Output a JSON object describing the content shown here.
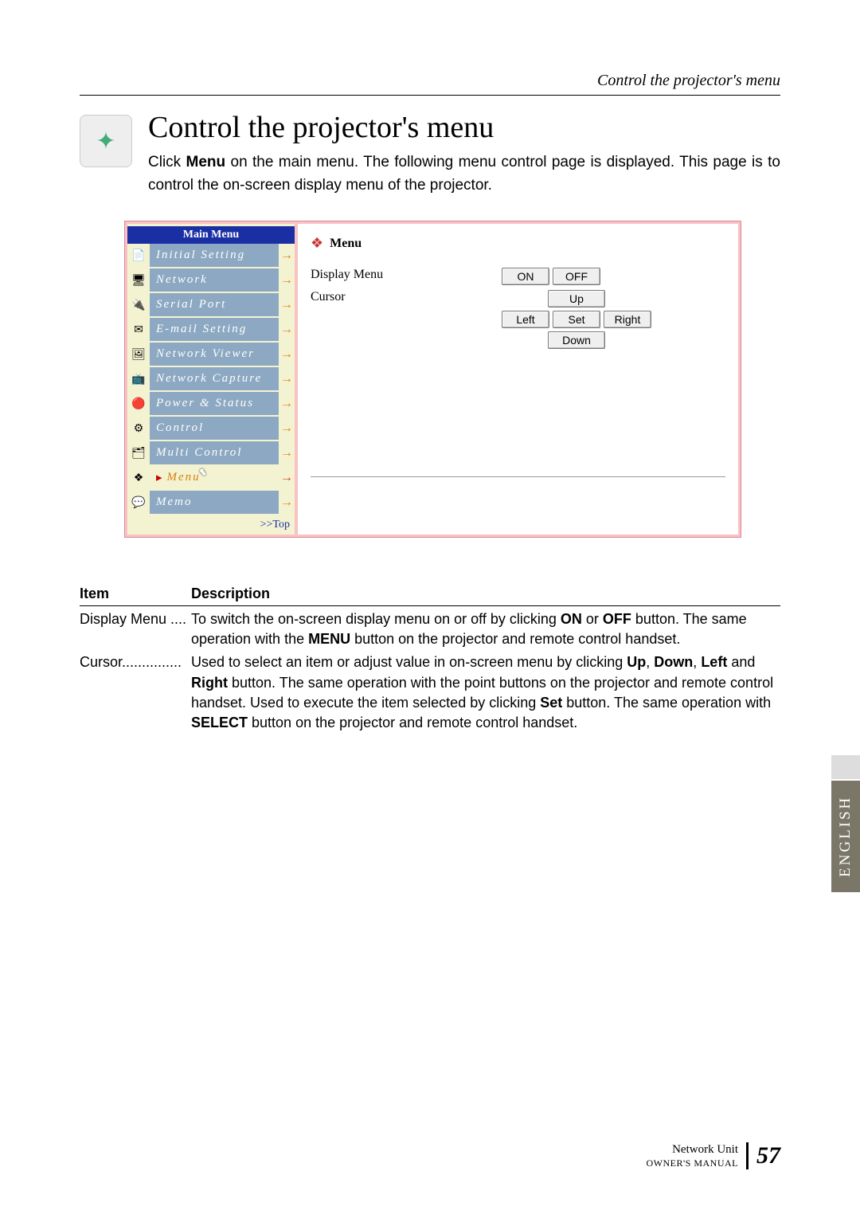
{
  "header": {
    "running_head": "Control the projector's menu",
    "title": "Control the projector's menu",
    "intro_parts": {
      "p1": "Click ",
      "b1": "Menu",
      "p2": " on the main menu. The following menu control page is displayed. This page is to control the on-screen display menu of the projector."
    }
  },
  "sidebar": {
    "title": "Main Menu",
    "items": [
      {
        "label": "Initial Setting",
        "icon": "📄"
      },
      {
        "label": "Network",
        "icon": "🖥"
      },
      {
        "label": "Serial Port",
        "icon": "🔌"
      },
      {
        "label": "E-mail Setting",
        "icon": "✉"
      },
      {
        "label": "Network Viewer",
        "icon": "🖼"
      },
      {
        "label": "Network Capture",
        "icon": "📺"
      },
      {
        "label": "Power & Status",
        "icon": "🔴"
      },
      {
        "label": "Control",
        "icon": "⚙"
      },
      {
        "label": "Multi Control",
        "icon": "🗂"
      },
      {
        "label": "Menu",
        "icon": "❖",
        "active": true
      },
      {
        "label": "Memo",
        "icon": "💬"
      }
    ],
    "top_link": ">>Top"
  },
  "panel": {
    "title": "Menu",
    "rows": {
      "display_menu": {
        "label": "Display Menu",
        "buttons": [
          "ON",
          "OFF"
        ]
      },
      "cursor": {
        "label": "Cursor",
        "up": "Up",
        "down": "Down",
        "left": "Left",
        "set": "Set",
        "right": "Right"
      }
    }
  },
  "table": {
    "head_item": "Item",
    "head_desc": "Description",
    "rows": [
      {
        "item": "Display Menu",
        "dots": " ....",
        "desc_parts": [
          {
            "t": "To switch the on-screen display menu on or off by clicking "
          },
          {
            "b": "ON"
          },
          {
            "t": " or "
          },
          {
            "b": "OFF"
          },
          {
            "t": " button. The same operation with the "
          },
          {
            "b": "MENU"
          },
          {
            "t": " button on the projector and remote control handset."
          }
        ]
      },
      {
        "item": "Cursor",
        "dots": "...............",
        "desc_parts": [
          {
            "t": "Used to select an item or adjust value in on-screen menu by clicking "
          },
          {
            "b": "Up"
          },
          {
            "t": ", "
          },
          {
            "b": "Down"
          },
          {
            "t": ", "
          },
          {
            "b": "Left"
          },
          {
            "t": " and "
          },
          {
            "b": "Right"
          },
          {
            "t": " button. The same operation with the point buttons on the projector and remote control handset. Used to execute the item selected by clicking "
          },
          {
            "b": "Set"
          },
          {
            "t": " button. The same operation with "
          },
          {
            "b": "SELECT"
          },
          {
            "t": " button on the projector and remote control handset."
          }
        ]
      }
    ]
  },
  "language_tab": "ENGLISH",
  "footer": {
    "line1": "Network Unit",
    "line2": "OWNER'S MANUAL",
    "page": "57"
  }
}
